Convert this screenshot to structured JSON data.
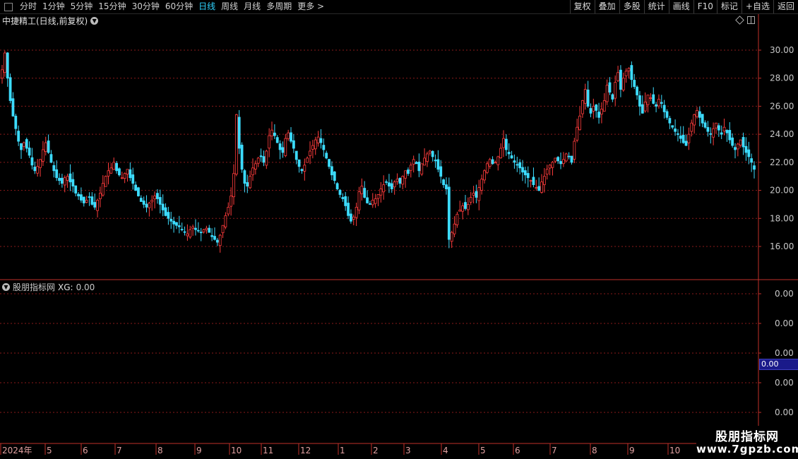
{
  "toolbar": {
    "periods": [
      {
        "label": "分时",
        "active": false
      },
      {
        "label": "1分钟",
        "active": false
      },
      {
        "label": "5分钟",
        "active": false
      },
      {
        "label": "15分钟",
        "active": false
      },
      {
        "label": "30分钟",
        "active": false
      },
      {
        "label": "60分钟",
        "active": false
      },
      {
        "label": "日线",
        "active": true
      },
      {
        "label": "周线",
        "active": false
      },
      {
        "label": "月线",
        "active": false
      },
      {
        "label": "多周期",
        "active": false
      },
      {
        "label": "更多 >",
        "active": false
      }
    ],
    "right_buttons": [
      "复权",
      "叠加",
      "多股",
      "统计",
      "画线",
      "F10",
      "标记",
      "+自选",
      "返回"
    ]
  },
  "main_chart": {
    "title": "中捷精工(日线,前复权)",
    "price_labels": [
      "30.00",
      "28.00",
      "26.00",
      "24.00",
      "22.00",
      "20.00",
      "18.00",
      "16.00"
    ]
  },
  "indicator": {
    "name": "股朋指标网",
    "series_label": "XG:",
    "series_value": "0.00",
    "axis_labels": [
      "0.00",
      "0.00",
      "0.00",
      "0.00",
      "0.00"
    ],
    "current_value": "0.00"
  },
  "time_axis": [
    "2024年",
    "5",
    "6",
    "7",
    "8",
    "9",
    "10",
    "11",
    "12",
    "1",
    "2",
    "3",
    "4",
    "5",
    "6",
    "7",
    "8",
    "9",
    "10"
  ],
  "watermark": {
    "line1": "股朋指标网",
    "line2": "www.7gpzb.com"
  },
  "colors": {
    "up": "#ff3c3c",
    "down": "#3cdcff",
    "grid": "#8a1a1a",
    "axis": "#c0302a",
    "active": "#2fd3ff"
  },
  "chart_data": {
    "type": "candlestick",
    "ylim": [
      14.5,
      31.5
    ],
    "closes": [
      28.6,
      29.8,
      28.0,
      26.4,
      25.3,
      24.4,
      23.5,
      22.9,
      23.4,
      23.0,
      22.5,
      21.8,
      21.4,
      21.7,
      22.2,
      22.9,
      23.4,
      22.7,
      22.0,
      21.4,
      20.9,
      20.7,
      20.5,
      20.9,
      21.0,
      20.6,
      20.3,
      19.8,
      19.6,
      19.3,
      19.1,
      19.3,
      19.5,
      19.0,
      18.8,
      19.3,
      19.8,
      20.5,
      21.0,
      21.4,
      21.6,
      22.0,
      21.4,
      21.1,
      20.9,
      21.2,
      21.5,
      20.9,
      20.5,
      20.0,
      19.6,
      19.2,
      19.0,
      18.8,
      19.1,
      19.3,
      19.6,
      19.4,
      19.0,
      18.6,
      18.2,
      18.0,
      17.8,
      17.6,
      17.5,
      17.4,
      17.2,
      17.0,
      16.9,
      17.2,
      17.4,
      17.2,
      17.1,
      17.0,
      17.2,
      17.3,
      17.0,
      16.7,
      16.5,
      16.3,
      16.8,
      17.5,
      18.2,
      18.8,
      19.6,
      21.2,
      25.4,
      23.0,
      21.5,
      20.5,
      20.3,
      21.0,
      21.6,
      21.9,
      22.3,
      22.4,
      22.0,
      22.8,
      23.9,
      24.3,
      23.9,
      23.4,
      22.9,
      22.7,
      23.7,
      24.1,
      23.5,
      23.0,
      22.2,
      21.7,
      21.4,
      21.8,
      22.3,
      22.8,
      23.2,
      23.6,
      23.8,
      23.4,
      22.9,
      22.3,
      21.7,
      21.1,
      20.7,
      20.1,
      19.7,
      19.4,
      18.9,
      18.2,
      17.8,
      18.1,
      18.8,
      19.9,
      20.3,
      19.5,
      19.1,
      19.0,
      19.3,
      19.4,
      19.7,
      20.1,
      20.4,
      20.6,
      20.3,
      20.1,
      20.6,
      20.8,
      20.5,
      21.0,
      21.4,
      21.2,
      21.8,
      22.2,
      21.9,
      21.4,
      21.9,
      22.3,
      22.6,
      22.8,
      22.4,
      22.1,
      21.5,
      21.0,
      20.4,
      20.1,
      16.5,
      17.0,
      17.6,
      18.3,
      18.6,
      18.9,
      18.7,
      19.0,
      19.5,
      19.8,
      19.5,
      20.2,
      20.8,
      21.4,
      21.9,
      22.2,
      21.9,
      22.0,
      22.4,
      23.0,
      23.7,
      22.9,
      22.6,
      22.3,
      22.0,
      21.8,
      21.6,
      21.3,
      21.1,
      20.9,
      20.7,
      20.4,
      20.2,
      20.0,
      20.6,
      21.0,
      21.5,
      21.8,
      22.0,
      22.3,
      22.1,
      21.9,
      22.2,
      22.6,
      22.4,
      22.0,
      23.5,
      24.5,
      25.3,
      26.4,
      27.2,
      26.0,
      25.5,
      26.0,
      25.7,
      25.2,
      25.8,
      26.4,
      27.5,
      27.0,
      26.5,
      27.7,
      28.4,
      27.2,
      28.0,
      28.5,
      28.7,
      27.9,
      27.4,
      26.8,
      26.0,
      25.5,
      26.3,
      26.8,
      26.6,
      26.2,
      26.0,
      26.5,
      26.2,
      25.6,
      25.2,
      24.8,
      24.5,
      24.2,
      24.0,
      23.7,
      23.4,
      23.2,
      24.0,
      24.8,
      25.4,
      25.7,
      25.2,
      24.8,
      24.5,
      24.2,
      24.0,
      24.4,
      24.8,
      24.3,
      24.0,
      24.5,
      24.1,
      23.6,
      23.2,
      22.9,
      23.3,
      23.6,
      23.1,
      22.7,
      22.4,
      22.0,
      21.5
    ]
  }
}
